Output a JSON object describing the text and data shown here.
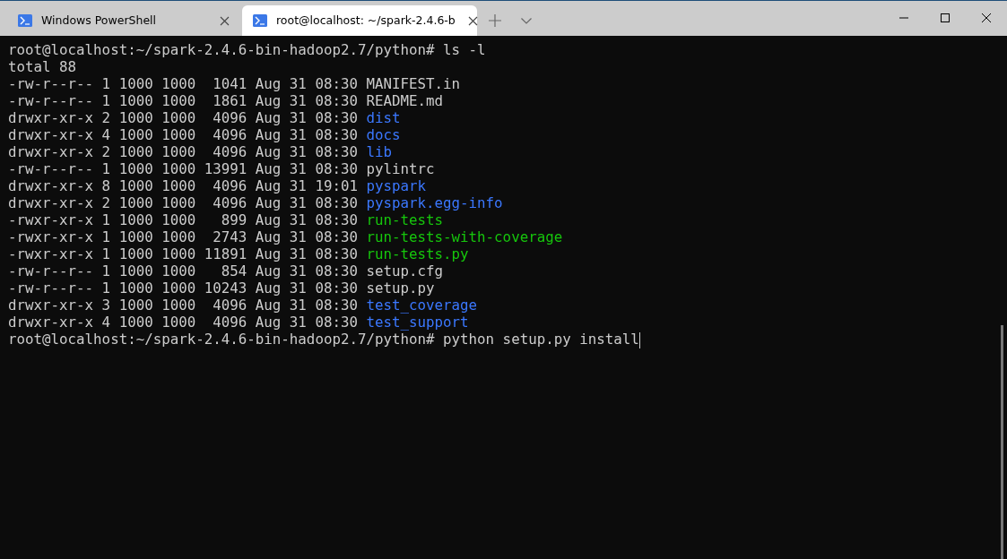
{
  "tabs": [
    {
      "title": "Windows PowerShell",
      "selected": false
    },
    {
      "title": "root@localhost: ~/spark-2.4.6-b",
      "selected": true
    }
  ],
  "lines": [
    {
      "kind": "prompt",
      "prompt": "root@localhost:~/spark-2.4.6-bin-hadoop2.7/python#",
      "command": "ls -l",
      "cursor": false
    },
    {
      "kind": "text",
      "text": "total 88"
    },
    {
      "kind": "file",
      "text": "-rw-r--r-- 1 1000 1000  1041 Aug 31 08:30",
      "file": "MANIFEST.in"
    },
    {
      "kind": "file",
      "text": "-rw-r--r-- 1 1000 1000  1861 Aug 31 08:30",
      "file": "README.md"
    },
    {
      "kind": "dir",
      "text": "drwxr-xr-x 2 1000 1000  4096 Aug 31 08:30",
      "file": "dist"
    },
    {
      "kind": "dir",
      "text": "drwxr-xr-x 4 1000 1000  4096 Aug 31 08:30",
      "file": "docs"
    },
    {
      "kind": "dir",
      "text": "drwxr-xr-x 2 1000 1000  4096 Aug 31 08:30",
      "file": "lib"
    },
    {
      "kind": "file",
      "text": "-rw-r--r-- 1 1000 1000 13991 Aug 31 08:30",
      "file": "pylintrc"
    },
    {
      "kind": "dir",
      "text": "drwxr-xr-x 8 1000 1000  4096 Aug 31 19:01",
      "file": "pyspark"
    },
    {
      "kind": "dir",
      "text": "drwxr-xr-x 2 1000 1000  4096 Aug 31 08:30",
      "file": "pyspark.egg-info"
    },
    {
      "kind": "exec",
      "text": "-rwxr-xr-x 1 1000 1000   899 Aug 31 08:30",
      "file": "run-tests"
    },
    {
      "kind": "exec",
      "text": "-rwxr-xr-x 1 1000 1000  2743 Aug 31 08:30",
      "file": "run-tests-with-coverage"
    },
    {
      "kind": "exec",
      "text": "-rwxr-xr-x 1 1000 1000 11891 Aug 31 08:30",
      "file": "run-tests.py"
    },
    {
      "kind": "file",
      "text": "-rw-r--r-- 1 1000 1000   854 Aug 31 08:30",
      "file": "setup.cfg"
    },
    {
      "kind": "file",
      "text": "-rw-r--r-- 1 1000 1000 10243 Aug 31 08:30",
      "file": "setup.py"
    },
    {
      "kind": "dir",
      "text": "drwxr-xr-x 3 1000 1000  4096 Aug 31 08:30",
      "file": "test_coverage"
    },
    {
      "kind": "dir",
      "text": "drwxr-xr-x 4 1000 1000  4096 Aug 31 08:30",
      "file": "test_support"
    },
    {
      "kind": "prompt",
      "prompt": "root@localhost:~/spark-2.4.6-bin-hadoop2.7/python#",
      "command": "python setup.py install",
      "cursor": true
    }
  ]
}
